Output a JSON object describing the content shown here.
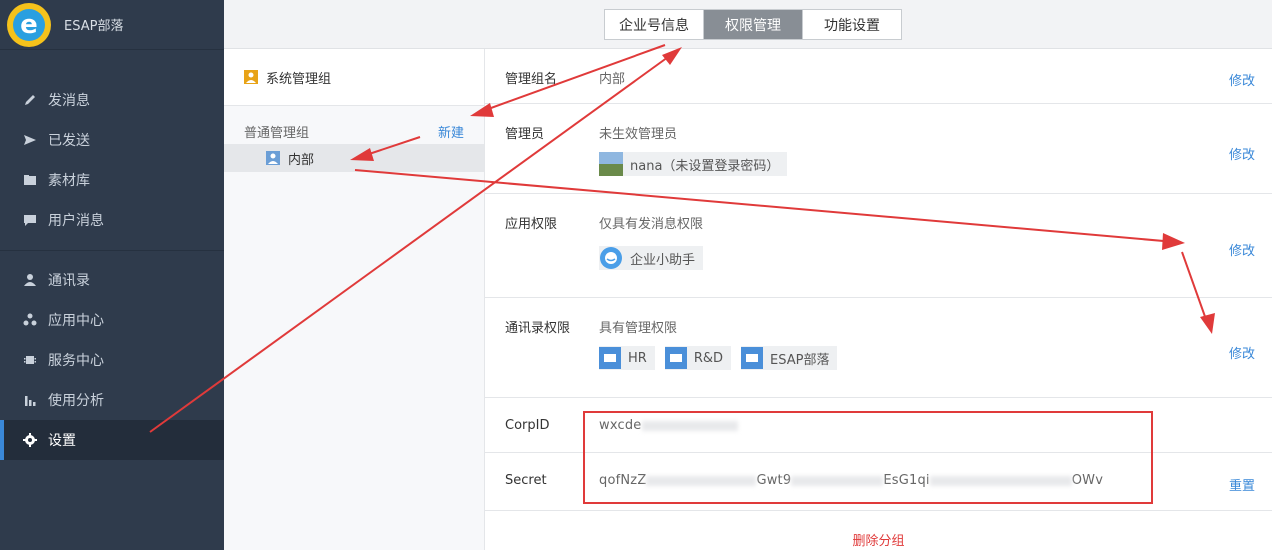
{
  "brand": {
    "name": "ESAP部落"
  },
  "nav": {
    "items": [
      {
        "label": "发消息",
        "icon": "pencil-icon"
      },
      {
        "label": "已发送",
        "icon": "send-icon"
      },
      {
        "label": "素材库",
        "icon": "folder-icon"
      },
      {
        "label": "用户消息",
        "icon": "chat-icon"
      },
      {
        "label": "通讯录",
        "icon": "person-icon"
      },
      {
        "label": "应用中心",
        "icon": "apps-icon"
      },
      {
        "label": "服务中心",
        "icon": "service-icon"
      },
      {
        "label": "使用分析",
        "icon": "bar-chart-icon"
      },
      {
        "label": "设置",
        "icon": "gear-icon",
        "active": true
      }
    ]
  },
  "tabs": {
    "items": [
      "企业号信息",
      "权限管理",
      "功能设置"
    ],
    "active": "权限管理"
  },
  "groups": {
    "system_group": "系统管理组",
    "normal_group_title": "普通管理组",
    "new_label": "新建",
    "sub_group": "内部"
  },
  "detail": {
    "group_name_label": "管理组名",
    "group_name_value": "内部",
    "admin_label": "管理员",
    "admin_status": "未生效管理员",
    "admin_user": "nana（未设置登录密码）",
    "app_perm_label": "应用权限",
    "app_perm_value": "仅具有发消息权限",
    "app_name": "企业小助手",
    "contact_perm_label": "通讯录权限",
    "contact_perm_value": "具有管理权限",
    "folders": [
      "HR",
      "R&D",
      "ESAP部落"
    ],
    "corpid_label": "CorpID",
    "corpid_value": "wxcde",
    "secret_label": "Secret",
    "secret_value_start": "qofNzZ",
    "secret_value_mid": "Gwt9",
    "secret_value_end": "EsG1qi",
    "secret_value_tail": "OWv",
    "edit_label": "修改",
    "reset_label": "重置",
    "delete_label": "删除分组"
  },
  "colors": {
    "accent": "#3a88d8",
    "sidebar_bg": "#2f3b4c",
    "annotation_red": "#e03a3a",
    "tab_active": "#888e95"
  }
}
